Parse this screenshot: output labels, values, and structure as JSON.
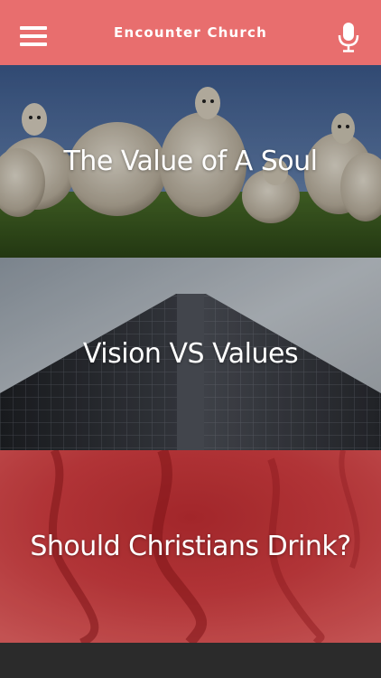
{
  "app_bar": {
    "title": "Encounter Church",
    "menu_icon": "hamburger-menu-icon",
    "mic_icon": "microphone-icon",
    "background_color": "#e86e6e"
  },
  "sermons": [
    {
      "title": "The Value of A Soul",
      "image": "sheep-in-field"
    },
    {
      "title": "Vision VS Values",
      "image": "skyscraper-looking-up"
    },
    {
      "title": "Should Christians Drink?",
      "image": "red-ink-in-water"
    }
  ]
}
